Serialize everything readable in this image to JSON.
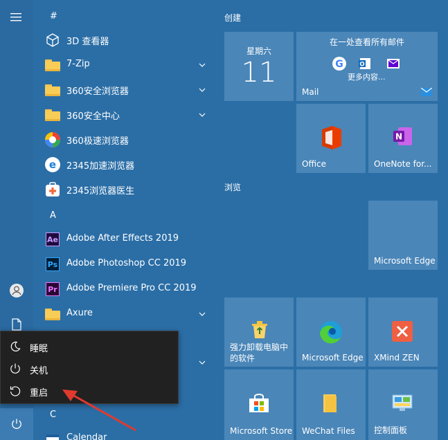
{
  "rail": {
    "hamburger_icon": "hamburger-icon",
    "user_icon": "user-icon",
    "document_icon": "document-icon",
    "power_icon": "power-icon"
  },
  "applist": {
    "section_hash": "#",
    "apps_hash": [
      {
        "name": "3D 查看器",
        "icon": "cube-icon",
        "expandable": false
      },
      {
        "name": "7-Zip",
        "icon": "folder-icon",
        "expandable": true
      },
      {
        "name": "360安全浏览器",
        "icon": "folder-icon",
        "expandable": true
      },
      {
        "name": "360安全中心",
        "icon": "folder-icon",
        "expandable": true
      },
      {
        "name": "360极速浏览器",
        "icon": "360-browser-icon",
        "expandable": false
      },
      {
        "name": "2345加速浏览器",
        "icon": "2345-browser-icon",
        "expandable": false
      },
      {
        "name": "2345浏览器医生",
        "icon": "doctor-icon",
        "expandable": false
      }
    ],
    "section_a": "A",
    "apps_a": [
      {
        "name": "Adobe After Effects 2019",
        "icon": "after-effects-icon",
        "abbr": "Ae"
      },
      {
        "name": "Adobe Photoshop CC 2019",
        "icon": "photoshop-icon",
        "abbr": "Ps"
      },
      {
        "name": "Adobe Premiere Pro CC 2019",
        "icon": "premiere-icon",
        "abbr": "Pr"
      },
      {
        "name": "Axure",
        "icon": "folder-icon",
        "expandable": true
      }
    ],
    "section_c": "C",
    "calendar": "Calendar"
  },
  "power_menu": {
    "items": [
      {
        "label": "睡眠",
        "icon": "sleep-icon"
      },
      {
        "label": "关机",
        "icon": "power-icon"
      },
      {
        "label": "重启",
        "icon": "restart-icon"
      }
    ]
  },
  "tiles": {
    "group_create": "创建",
    "group_browse": "浏览",
    "calendar_tile": {
      "weekday": "星期六",
      "day": "11"
    },
    "mail_tile": {
      "heading": "在一处查看所有邮件",
      "more": "更多内容...",
      "label": "Mail"
    },
    "office": "Office",
    "onenote": "OneNote for...",
    "edge_large": "Microsoft Edge",
    "uninstall": "强力卸载电脑中的软件",
    "edge": "Microsoft Edge",
    "xmind": "XMind ZEN",
    "store": "Microsoft Store",
    "wechat": "WeChat Files",
    "control": "控制面板"
  },
  "colors": {
    "accent": "#2b6ea6",
    "tile": "#4a86b8",
    "menu_bg": "#212121",
    "arrow": "#e03a2f"
  }
}
